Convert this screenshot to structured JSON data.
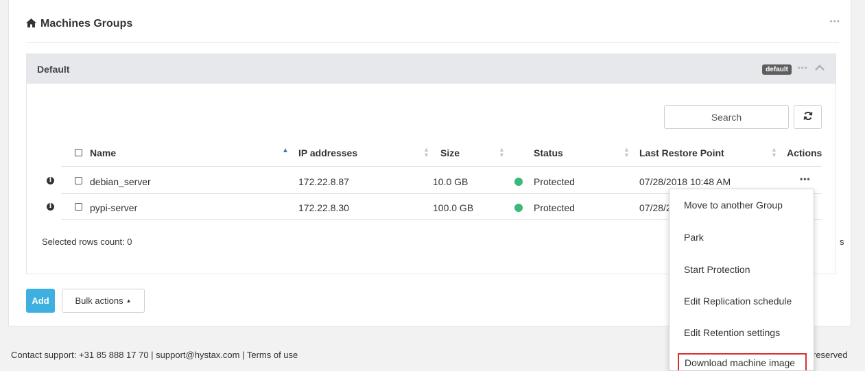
{
  "panel": {
    "title": "Machines Groups",
    "title_icon": "home-icon"
  },
  "group": {
    "name": "Default",
    "badge": "default"
  },
  "search": {
    "placeholder": "Search"
  },
  "table": {
    "headers": {
      "name": "Name",
      "ip": "IP addresses",
      "size": "Size",
      "status": "Status",
      "last_restore": "Last Restore Point",
      "actions": "Actions"
    },
    "rows": [
      {
        "name": "debian_server",
        "ip": "172.22.8.87",
        "size": "10.0 GB",
        "status": "Protected",
        "last_restore": "07/28/2018 10:48 AM"
      },
      {
        "name": "pypi-server",
        "ip": "172.22.8.30",
        "size": "100.0 GB",
        "status": "Protected",
        "last_restore": "07/28/20"
      }
    ],
    "selected_count": "Selected rows count: 0",
    "peek_text": "s"
  },
  "buttons": {
    "add": "Add",
    "bulk_actions": "Bulk actions"
  },
  "dropdown": {
    "items": [
      "Move to another Group",
      "Park",
      "Start Protection",
      "Edit Replication schedule",
      "Edit Retention settings",
      "Download machine image"
    ]
  },
  "footer": {
    "contact": "Contact support: +31 85 888 17 70 | support@hystax.com | Terms of use",
    "right_text": "reserved"
  },
  "colors": {
    "accent": "#3eb0e0",
    "status_protected": "#3cb878",
    "highlight_border": "#d9302c"
  }
}
